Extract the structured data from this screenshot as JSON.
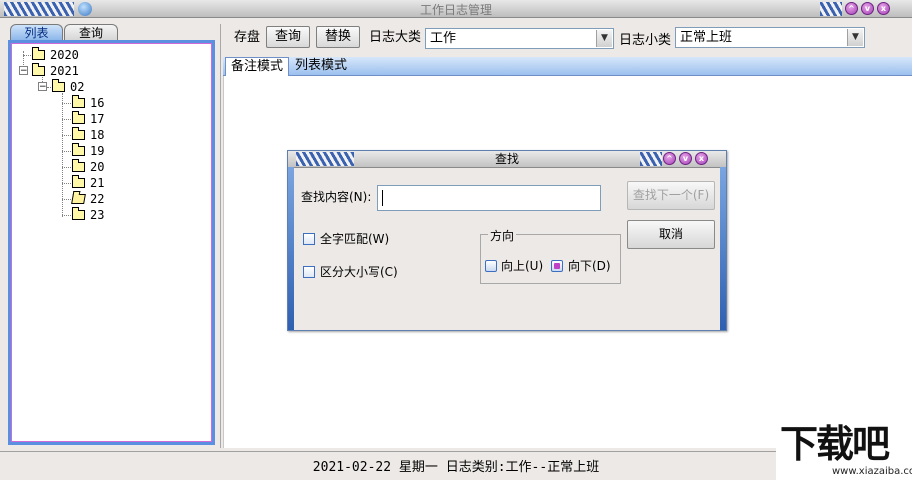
{
  "window": {
    "title": "工作日志管理"
  },
  "left_tabs": [
    "列表",
    "查询"
  ],
  "tree": {
    "years": [
      {
        "label": "2020",
        "expanded": false
      },
      {
        "label": "2021",
        "expanded": true
      }
    ],
    "month": "02",
    "days": [
      "16",
      "17",
      "18",
      "19",
      "20",
      "21",
      "22",
      "23"
    ],
    "open_day": "22"
  },
  "toolbar": {
    "save_label": "存盘",
    "query_label": "查询",
    "replace_label": "替换",
    "major_label": "日志大类",
    "major_value": "工作",
    "minor_label": "日志小类",
    "minor_value": "正常上班"
  },
  "mode_tabs": [
    "备注模式",
    "列表模式"
  ],
  "find_dialog": {
    "title": "查找",
    "find_label": "查找内容(N):",
    "find_value": "",
    "find_next": "查找下一个(F)",
    "cancel": "取消",
    "whole_word": "全字匹配(W)",
    "match_case": "区分大小写(C)",
    "direction_title": "方向",
    "up": "向上(U)",
    "down": "向下(D)",
    "direction_selected": "down"
  },
  "status": {
    "text": "2021-02-22 星期一 日志类别:工作--正常上班"
  },
  "watermark": {
    "main": "下载吧",
    "sub": "www.xiazaiba.com"
  },
  "colors": {
    "accent": "#5b8fe0",
    "tree_border_inner": "#d06ad8",
    "title_buttons": "#a43fb8"
  },
  "icons": [
    "app-icon",
    "minimize-icon",
    "maximize-icon",
    "close-icon",
    "folder-icon",
    "dropdown-arrow-icon"
  ]
}
